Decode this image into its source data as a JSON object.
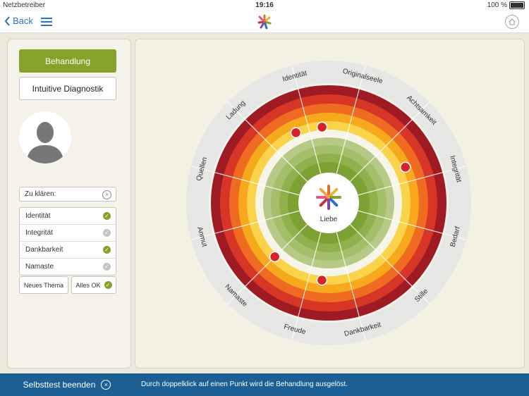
{
  "statusbar": {
    "carrier": "Netzbetreiber",
    "time": "19:16",
    "battery": "100 %"
  },
  "nav": {
    "back_label": "Back"
  },
  "left": {
    "treatment_button": "Behandlung",
    "diagnostics_button": "Intuitive Diagnostik",
    "clarify_label": "Zu klären:",
    "topics": [
      {
        "label": "Identität",
        "checked": true
      },
      {
        "label": "Integrität",
        "checked": false
      },
      {
        "label": "Dankbarkeit",
        "checked": true
      },
      {
        "label": "Namaste",
        "checked": false
      }
    ],
    "new_topic_button": "Neues Thema",
    "all_ok_button": "Alles OK"
  },
  "wheel": {
    "center_label": "Liebe",
    "segments": [
      "Identität",
      "Originalseele",
      "Achtsamkeit",
      "Integrität",
      "Bedarf",
      "Stille",
      "Dankbarkeit",
      "Freude",
      "Namaste",
      "Anmut",
      "Quellen",
      "Ladung"
    ]
  },
  "bottombar": {
    "end_button": "Selbsttest beenden",
    "hint": "Durch doppelklick auf einen Punkt wird die Behandlung ausgelöst."
  },
  "colors": {
    "accent_green": "#86a22b",
    "brand_blue": "#1b5f95",
    "link_blue": "#2a72c7",
    "marker_red": "#d8222a"
  }
}
